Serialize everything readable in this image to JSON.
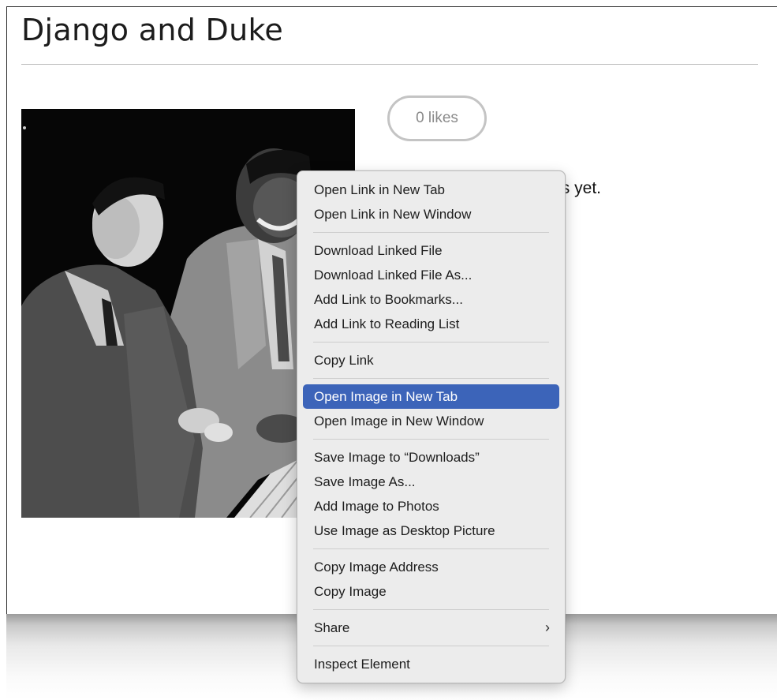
{
  "page": {
    "title": "Django and Duke",
    "likes_label": "0 likes",
    "comments_visible_text": "No comments yet."
  },
  "photo": {
    "description": "black-and-white photo of two men at a piano"
  },
  "context_menu": {
    "selected_item": "Open Image in New Tab",
    "groups": [
      [
        {
          "label": "Open Link in New Tab"
        },
        {
          "label": "Open Link in New Window"
        }
      ],
      [
        {
          "label": "Download Linked File"
        },
        {
          "label": "Download Linked File As..."
        },
        {
          "label": "Add Link to Bookmarks..."
        },
        {
          "label": "Add Link to Reading List"
        }
      ],
      [
        {
          "label": "Copy Link"
        }
      ],
      [
        {
          "label": "Open Image in New Tab"
        },
        {
          "label": "Open Image in New Window"
        }
      ],
      [
        {
          "label": "Save Image to “Downloads”"
        },
        {
          "label": "Save Image As..."
        },
        {
          "label": "Add Image to Photos"
        },
        {
          "label": "Use Image as Desktop Picture"
        }
      ],
      [
        {
          "label": "Copy Image Address"
        },
        {
          "label": "Copy Image"
        }
      ],
      [
        {
          "label": "Share",
          "submenu_icon": "chevron-right-icon",
          "submenu_glyph": "›"
        }
      ],
      [
        {
          "label": "Inspect Element"
        }
      ]
    ]
  },
  "colors": {
    "selection": "#3c64b9",
    "menu_background": "#ececec",
    "likes_border": "#c4c4c4"
  }
}
